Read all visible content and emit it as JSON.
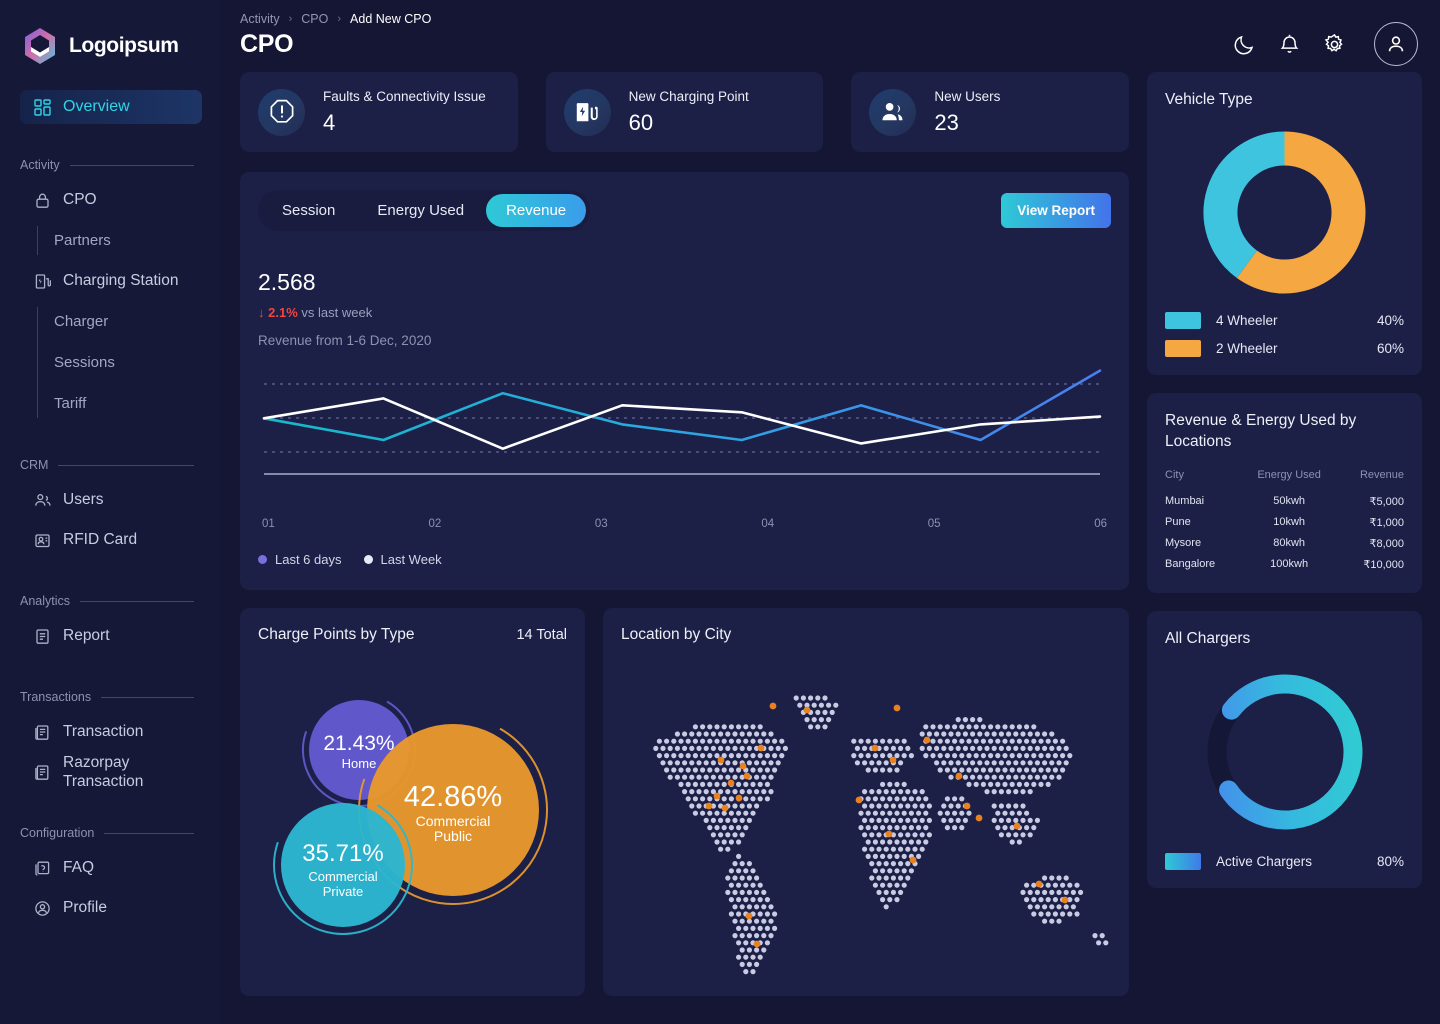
{
  "brand": {
    "name": "Logoipsum"
  },
  "sidebar": {
    "active": {
      "label": "Overview",
      "icon": "dashboard-grid-icon"
    },
    "sections": [
      {
        "title": "Activity",
        "items": [
          {
            "label": "CPO",
            "icon": "lock-icon",
            "sub": [
              "Partners"
            ]
          },
          {
            "label": "Charging Station",
            "icon": "charging-station-icon",
            "sub": [
              "Charger",
              "Sessions",
              "Tariff"
            ]
          }
        ]
      },
      {
        "title": "CRM",
        "items": [
          {
            "label": "Users",
            "icon": "users-icon",
            "sub": []
          },
          {
            "label": "RFID Card",
            "icon": "id-card-icon",
            "sub": []
          }
        ]
      },
      {
        "title": "Analytics",
        "items": [
          {
            "label": "Report",
            "icon": "document-icon",
            "sub": []
          }
        ]
      },
      {
        "title": "Transactions",
        "items": [
          {
            "label": "Transaction",
            "icon": "receipt-icon",
            "sub": []
          },
          {
            "label": "Razorpay Transaction",
            "icon": "receipt-icon",
            "sub": []
          }
        ]
      },
      {
        "title": "Configuration",
        "items": [
          {
            "label": "FAQ",
            "icon": "question-box-icon",
            "sub": []
          },
          {
            "label": "Profile",
            "icon": "profile-icon",
            "sub": []
          }
        ]
      }
    ]
  },
  "header": {
    "breadcrumb": [
      "Activity",
      "CPO",
      "Add New CPO"
    ],
    "separator": "›",
    "title": "CPO",
    "icons": [
      "moon-icon",
      "bell-icon",
      "gear-icon",
      "user-avatar-icon"
    ]
  },
  "stats": [
    {
      "label": "Faults & Connectivity Issue",
      "value": "4",
      "icon": "alert-octagon-icon"
    },
    {
      "label": "New Charging Point",
      "value": "60",
      "icon": "ev-charger-icon"
    },
    {
      "label": "New Users",
      "value": "23",
      "icon": "people-icon"
    }
  ],
  "revenue": {
    "tabs": [
      {
        "label": "Session",
        "active": false
      },
      {
        "label": "Energy Used",
        "active": false
      },
      {
        "label": "Revenue",
        "active": true
      }
    ],
    "action": "View Report",
    "value": "2.568",
    "delta_arrow": "↓",
    "delta_pct": "2.1%",
    "delta_suffix": "vs last week",
    "subtitle": "Revenue from 1-6 Dec, 2020",
    "legend": [
      {
        "label": "Last 6 days",
        "color": "#7b6fdd"
      },
      {
        "label": "Last Week",
        "color": "#e9ebf4"
      }
    ]
  },
  "chart_data": [
    {
      "type": "line",
      "title": "Revenue from 1-6 Dec, 2020",
      "xlabel": "",
      "ylabel": "",
      "categories": [
        "01",
        "02",
        "03",
        "04",
        "05",
        "06"
      ],
      "x": [
        1,
        2,
        3,
        4,
        5,
        6
      ],
      "ylim": [
        0,
        100
      ],
      "grid": "horizontal-dotted",
      "legend_position": "bottom-left",
      "series": [
        {
          "name": "Last 6 days",
          "color": "#2fb5d8",
          "values": [
            55,
            30,
            84,
            48,
            30,
            70,
            30,
            110
          ]
        },
        {
          "name": "Last Week",
          "color": "#ffffff",
          "values": [
            55,
            78,
            20,
            70,
            62,
            26,
            48,
            57
          ]
        }
      ]
    },
    {
      "type": "pie",
      "title": "Vehicle Type",
      "labels": [
        "4 Wheeler",
        "2 Wheeler"
      ],
      "values": [
        40,
        60
      ],
      "colors": [
        "#3fc4e0",
        "#f5a742"
      ],
      "donut": true,
      "legend_position": "bottom"
    },
    {
      "type": "pie",
      "title": "All Chargers",
      "labels": [
        "Active Chargers"
      ],
      "values": [
        80
      ],
      "colors": [
        "#35c6d8"
      ],
      "donut": true,
      "legend_position": "bottom"
    },
    {
      "type": "scatter",
      "title": "Charge Points by Type",
      "subtitle": "14 Total",
      "labels": [
        "Home",
        "Commercial Public",
        "Commercial Private"
      ],
      "values": [
        21.43,
        42.86,
        35.71
      ],
      "colors": [
        "#6259ce",
        "#e8982c",
        "#2cb6cf"
      ]
    },
    {
      "type": "table",
      "title": "Revenue & Energy Used by Locations",
      "columns": [
        "City",
        "Energy Used",
        "Revenue"
      ],
      "rows": [
        [
          "Mumbai",
          "50kwh",
          "₹5,000"
        ],
        [
          "Pune",
          "10kwh",
          "₹1,000"
        ],
        [
          "Mysore",
          "80kwh",
          "₹8,000"
        ],
        [
          "Bangalore",
          "100kwh",
          "₹10,000"
        ]
      ]
    }
  ],
  "charge_points": {
    "title": "Charge Points by Type",
    "total": "14 Total",
    "bubbles": [
      {
        "pct": "21.43%",
        "label": "Home",
        "color": "#6259ce"
      },
      {
        "pct": "42.86%",
        "label": "Commercial\nPublic",
        "label_line1": "Commercial",
        "label_line2": "Public",
        "color": "#e8982c"
      },
      {
        "pct": "35.71%",
        "label_line1": "Commercial",
        "label_line2": "Private",
        "color": "#2cb6cf"
      }
    ]
  },
  "map": {
    "title": "Location by City",
    "marker_color": "#e8811f"
  },
  "vehicle_type": {
    "title": "Vehicle Type",
    "legend": [
      {
        "name": "4 Wheeler",
        "pct": "40%",
        "color": "#3fc4e0"
      },
      {
        "name": "2 Wheeler",
        "pct": "60%",
        "color": "#f5a742"
      }
    ]
  },
  "locations": {
    "title": "Revenue & Energy Used by Locations",
    "columns": [
      "City",
      "Energy Used",
      "Revenue"
    ],
    "rows": [
      {
        "city": "Mumbai",
        "energy": "50kwh",
        "revenue": "₹5,000"
      },
      {
        "city": "Pune",
        "energy": "10kwh",
        "revenue": "₹1,000"
      },
      {
        "city": "Mysore",
        "energy": "80kwh",
        "revenue": "₹8,000"
      },
      {
        "city": "Bangalore",
        "energy": "100kwh",
        "revenue": "₹10,000"
      }
    ]
  },
  "all_chargers": {
    "title": "All Chargers",
    "legend": [
      {
        "name": "Active Chargers",
        "pct": "80%"
      }
    ]
  }
}
